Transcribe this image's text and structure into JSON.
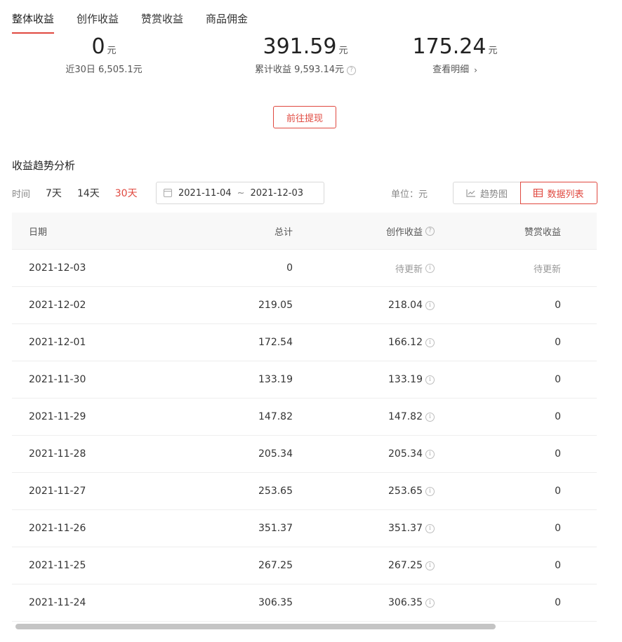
{
  "tabs": [
    {
      "label": "整体收益",
      "active": true
    },
    {
      "label": "创作收益",
      "active": false
    },
    {
      "label": "赞赏收益",
      "active": false
    },
    {
      "label": "商品佣金",
      "active": false
    }
  ],
  "stats": [
    {
      "value": "0",
      "unit": "元",
      "sub": "近30日 6,505.1元"
    },
    {
      "value": "391.59",
      "unit": "元",
      "sub": "累计收益 9,593.14元"
    },
    {
      "value": "175.24",
      "unit": "元",
      "sub": "查看明细"
    }
  ],
  "withdraw_label": "前往提现",
  "section_title": "收益趋势分析",
  "filter": {
    "time_label": "时间",
    "ranges": [
      "7天",
      "14天",
      "30天"
    ],
    "active_range": "30天",
    "date_start": "2021-11-04",
    "date_sep": "~",
    "date_end": "2021-12-03",
    "unit_label": "单位：元",
    "trend_label": "趋势图",
    "list_label": "数据列表"
  },
  "table": {
    "headers": [
      "日期",
      "总计",
      "创作收益",
      "赞赏收益"
    ],
    "rows": [
      {
        "date": "2021-12-03",
        "total": "0",
        "creation": "待更新",
        "reward": "待更新"
      },
      {
        "date": "2021-12-02",
        "total": "219.05",
        "creation": "218.04",
        "reward": "0"
      },
      {
        "date": "2021-12-01",
        "total": "172.54",
        "creation": "166.12",
        "reward": "0"
      },
      {
        "date": "2021-11-30",
        "total": "133.19",
        "creation": "133.19",
        "reward": "0"
      },
      {
        "date": "2021-11-29",
        "total": "147.82",
        "creation": "147.82",
        "reward": "0"
      },
      {
        "date": "2021-11-28",
        "total": "205.34",
        "creation": "205.34",
        "reward": "0"
      },
      {
        "date": "2021-11-27",
        "total": "253.65",
        "creation": "253.65",
        "reward": "0"
      },
      {
        "date": "2021-11-26",
        "total": "351.37",
        "creation": "351.37",
        "reward": "0"
      },
      {
        "date": "2021-11-25",
        "total": "267.25",
        "creation": "267.25",
        "reward": "0"
      },
      {
        "date": "2021-11-24",
        "total": "306.35",
        "creation": "306.35",
        "reward": "0"
      }
    ]
  },
  "colors": {
    "accent": "#e0483f",
    "header_bg": "#f8f8f8"
  }
}
